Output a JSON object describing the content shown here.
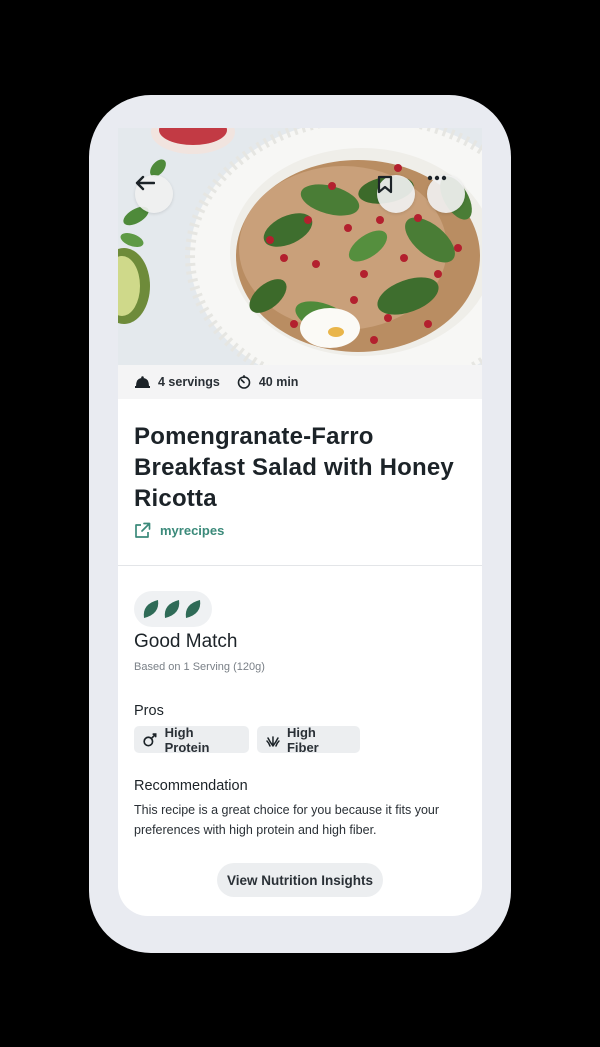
{
  "recipe": {
    "servings": "4 servings",
    "time": "40 min",
    "title": "Pomengranate-Farro Breakfast Salad with Honey Ricotta",
    "source": "myrecipes"
  },
  "match": {
    "label": "Good Match",
    "basis": "Based on 1 Serving (120g)",
    "rating_leaves": 3,
    "leaf_color": "#2f6b57"
  },
  "pros": {
    "heading": "Pros",
    "items": [
      {
        "label": "High Protein",
        "icon": "protein-icon"
      },
      {
        "label": "High Fiber",
        "icon": "fiber-icon"
      }
    ]
  },
  "recommendation": {
    "heading": "Recommendation",
    "text": "This recipe is a great choice for you because it fits your preferences with high protein and high fiber."
  },
  "cta": {
    "label": "View Nutrition Insights"
  },
  "colors": {
    "accent": "#3b8a7a",
    "background": "#000000",
    "device_frame": "#e9ebf1"
  }
}
